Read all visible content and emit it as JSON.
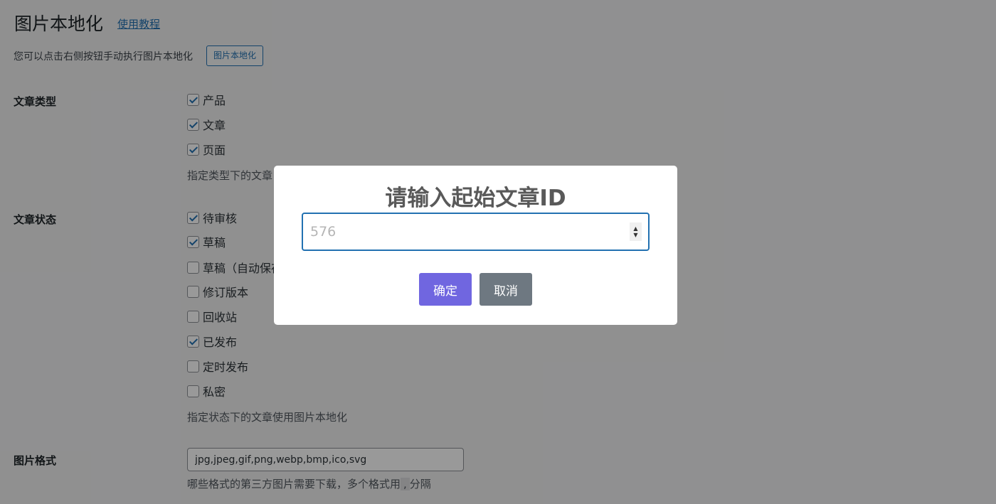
{
  "header": {
    "title": "图片本地化",
    "tutorial_link": "使用教程",
    "intro": "您可以点击右侧按钮手动执行图片本地化",
    "localize_button": "图片本地化"
  },
  "post_types": {
    "label": "文章类型",
    "options": [
      {
        "label": "产品",
        "checked": true
      },
      {
        "label": "文章",
        "checked": true
      },
      {
        "label": "页面",
        "checked": true
      }
    ],
    "description": "指定类型下的文章"
  },
  "post_status": {
    "label": "文章状态",
    "options": [
      {
        "label": "待审核",
        "checked": true
      },
      {
        "label": "草稿",
        "checked": true
      },
      {
        "label": "草稿（自动保存",
        "checked": false
      },
      {
        "label": "修订版本",
        "checked": false
      },
      {
        "label": "回收站",
        "checked": false
      },
      {
        "label": "已发布",
        "checked": true
      },
      {
        "label": "定时发布",
        "checked": false
      },
      {
        "label": "私密",
        "checked": false
      }
    ],
    "description": "指定状态下的文章使用图片本地化"
  },
  "image_format": {
    "label": "图片格式",
    "value": "jpg,jpeg,gif,png,webp,bmp,ico,svg",
    "description_before": "哪些格式的第三方图片需要下载，多个格式用",
    "description_code": ",",
    "description_after": "分隔"
  },
  "dialog": {
    "title": "请输入起始文章ID",
    "input_placeholder": "576",
    "confirm_label": "确定",
    "cancel_label": "取消",
    "confirm_color": "#7066e0",
    "cancel_color": "#6e7881"
  },
  "icons": {
    "spinner_up": "▲",
    "spinner_down": "▼"
  }
}
